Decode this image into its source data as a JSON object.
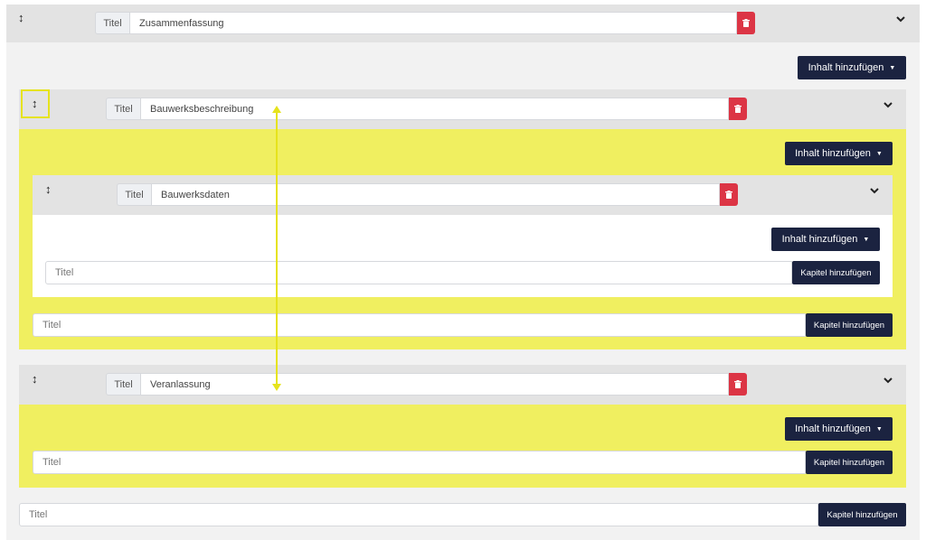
{
  "common": {
    "title_addon": "Titel",
    "title_placeholder": "Titel",
    "add_content_label": "Inhalt hinzufügen",
    "add_chapter_label": "Kapitel hinzufügen"
  },
  "sections": [
    {
      "title": "Zusammenfassung"
    },
    {
      "title": "Bauwerksbeschreibung"
    },
    {
      "title": "Bauwerksdaten"
    },
    {
      "title": "Veranlassung"
    }
  ],
  "icons": {
    "drag": "drag-handle-icon",
    "delete": "trash-icon",
    "collapse": "chevron-down-icon",
    "dropdown": "caret-down-icon"
  },
  "colors": {
    "highlight": "#f0ef60",
    "button": "#1b2340",
    "delete": "#dc3545",
    "drop_indicator": "#e6e31c"
  }
}
